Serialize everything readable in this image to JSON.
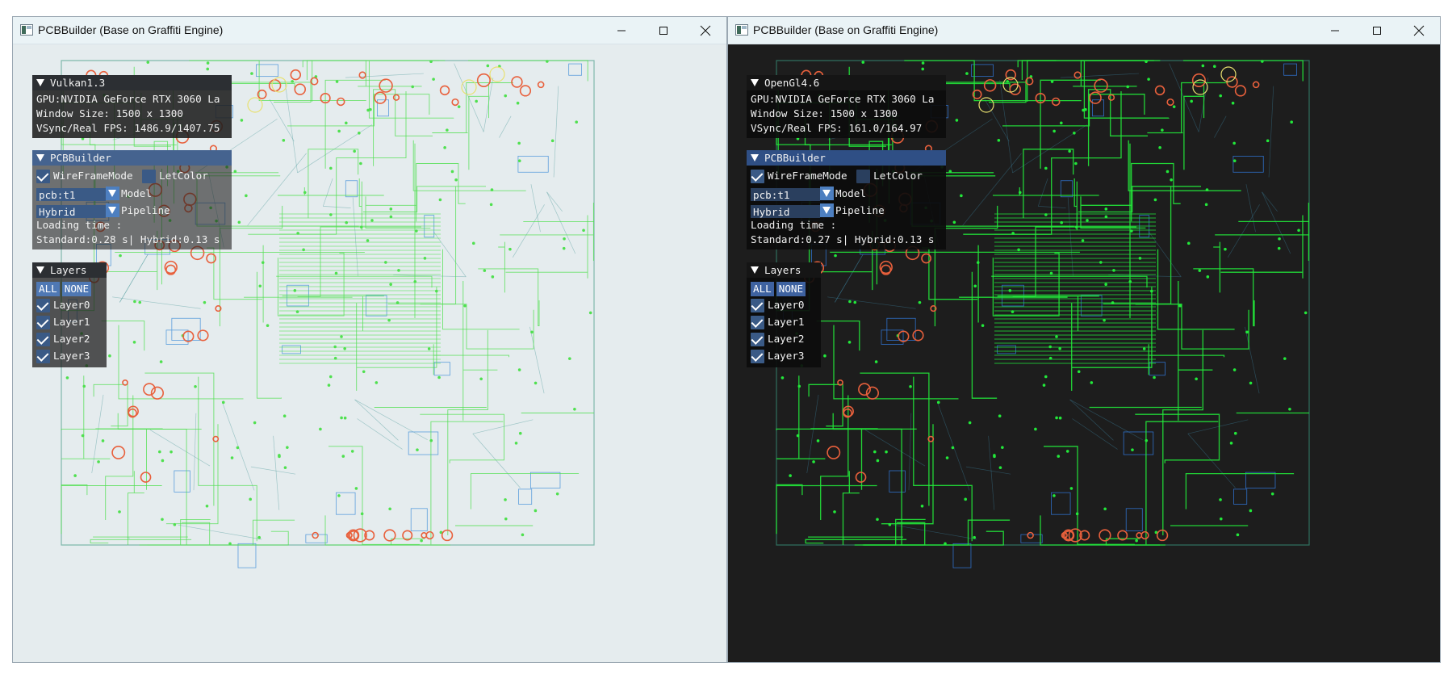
{
  "windows": [
    {
      "title": "PCBBuilder (Base on Graffiti Engine)",
      "theme": "light",
      "info_panel": {
        "header": "Vulkan1.3",
        "lines": [
          "GPU:NVIDIA GeForce RTX 3060 La",
          "Window Size: 1500 x 1300",
          "VSync/Real FPS: 1486.9/1407.75"
        ]
      },
      "builder_panel": {
        "header": "PCBBuilder",
        "wireframe_label": "WireFrameMode",
        "wireframe_checked": true,
        "letcolor_label": "LetColor",
        "letcolor_checked": false,
        "model_value": "pcb:t1",
        "model_label": "Model",
        "pipeline_value": "Hybrid",
        "pipeline_label": "Pipeline",
        "loading_label": "Loading time :",
        "loading_value": "Standard:0.28 s| Hybrid:0.13 s"
      },
      "layers_panel": {
        "header": "Layers",
        "all_label": "ALL",
        "none_label": "NONE",
        "layers": [
          {
            "label": "Layer0",
            "checked": true
          },
          {
            "label": "Layer1",
            "checked": true
          },
          {
            "label": "Layer2",
            "checked": true
          },
          {
            "label": "Layer3",
            "checked": true
          }
        ]
      }
    },
    {
      "title": "PCBBuilder (Base on Graffiti Engine)",
      "theme": "dark",
      "info_panel": {
        "header": "OpenGl4.6",
        "lines": [
          "GPU:NVIDIA GeForce RTX 3060 La",
          "Window Size: 1500 x 1300",
          "VSync/Real FPS: 161.0/164.97"
        ]
      },
      "builder_panel": {
        "header": "PCBBuilder",
        "wireframe_label": "WireFrameMode",
        "wireframe_checked": true,
        "letcolor_label": "LetColor",
        "letcolor_checked": false,
        "model_value": "pcb:t1",
        "model_label": "Model",
        "pipeline_value": "Hybrid",
        "pipeline_label": "Pipeline",
        "loading_label": "Loading time :",
        "loading_value": "Standard:0.27 s| Hybrid:0.13 s"
      },
      "layers_panel": {
        "header": "Layers",
        "all_label": "ALL",
        "none_label": "NONE",
        "layers": [
          {
            "label": "Layer0",
            "checked": true
          },
          {
            "label": "Layer1",
            "checked": true
          },
          {
            "label": "Layer2",
            "checked": true
          },
          {
            "label": "Layer3",
            "checked": true
          }
        ]
      }
    }
  ],
  "icons": {
    "app": "pcb-app-icon",
    "minimize": "minimize-icon",
    "maximize": "maximize-icon",
    "close": "close-icon"
  },
  "colors": {
    "trace_green": "#33ff33",
    "wire_blue": "#3a8ad8",
    "pad_orange": "#e8603c",
    "pad_yellow": "#e8e070",
    "panel_header_blue": "#3c5f92",
    "panel_bg_dark": "#1c1c1c"
  }
}
